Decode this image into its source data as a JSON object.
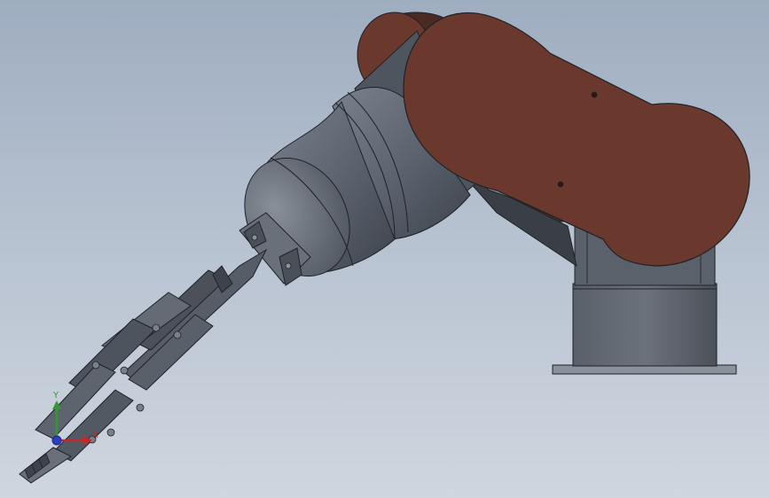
{
  "viewport": {
    "background_top": "#9fadc0",
    "background_bottom": "#cfd6df"
  },
  "model": {
    "body_color": "#5d6470",
    "link_color": "#6a382c",
    "edge_color": "#1e2228"
  },
  "triad": {
    "x_label": "X",
    "y_label": "Y",
    "x_color": "#c8262a",
    "y_color": "#2f9a2f",
    "z_color": "#2a3fc0"
  }
}
